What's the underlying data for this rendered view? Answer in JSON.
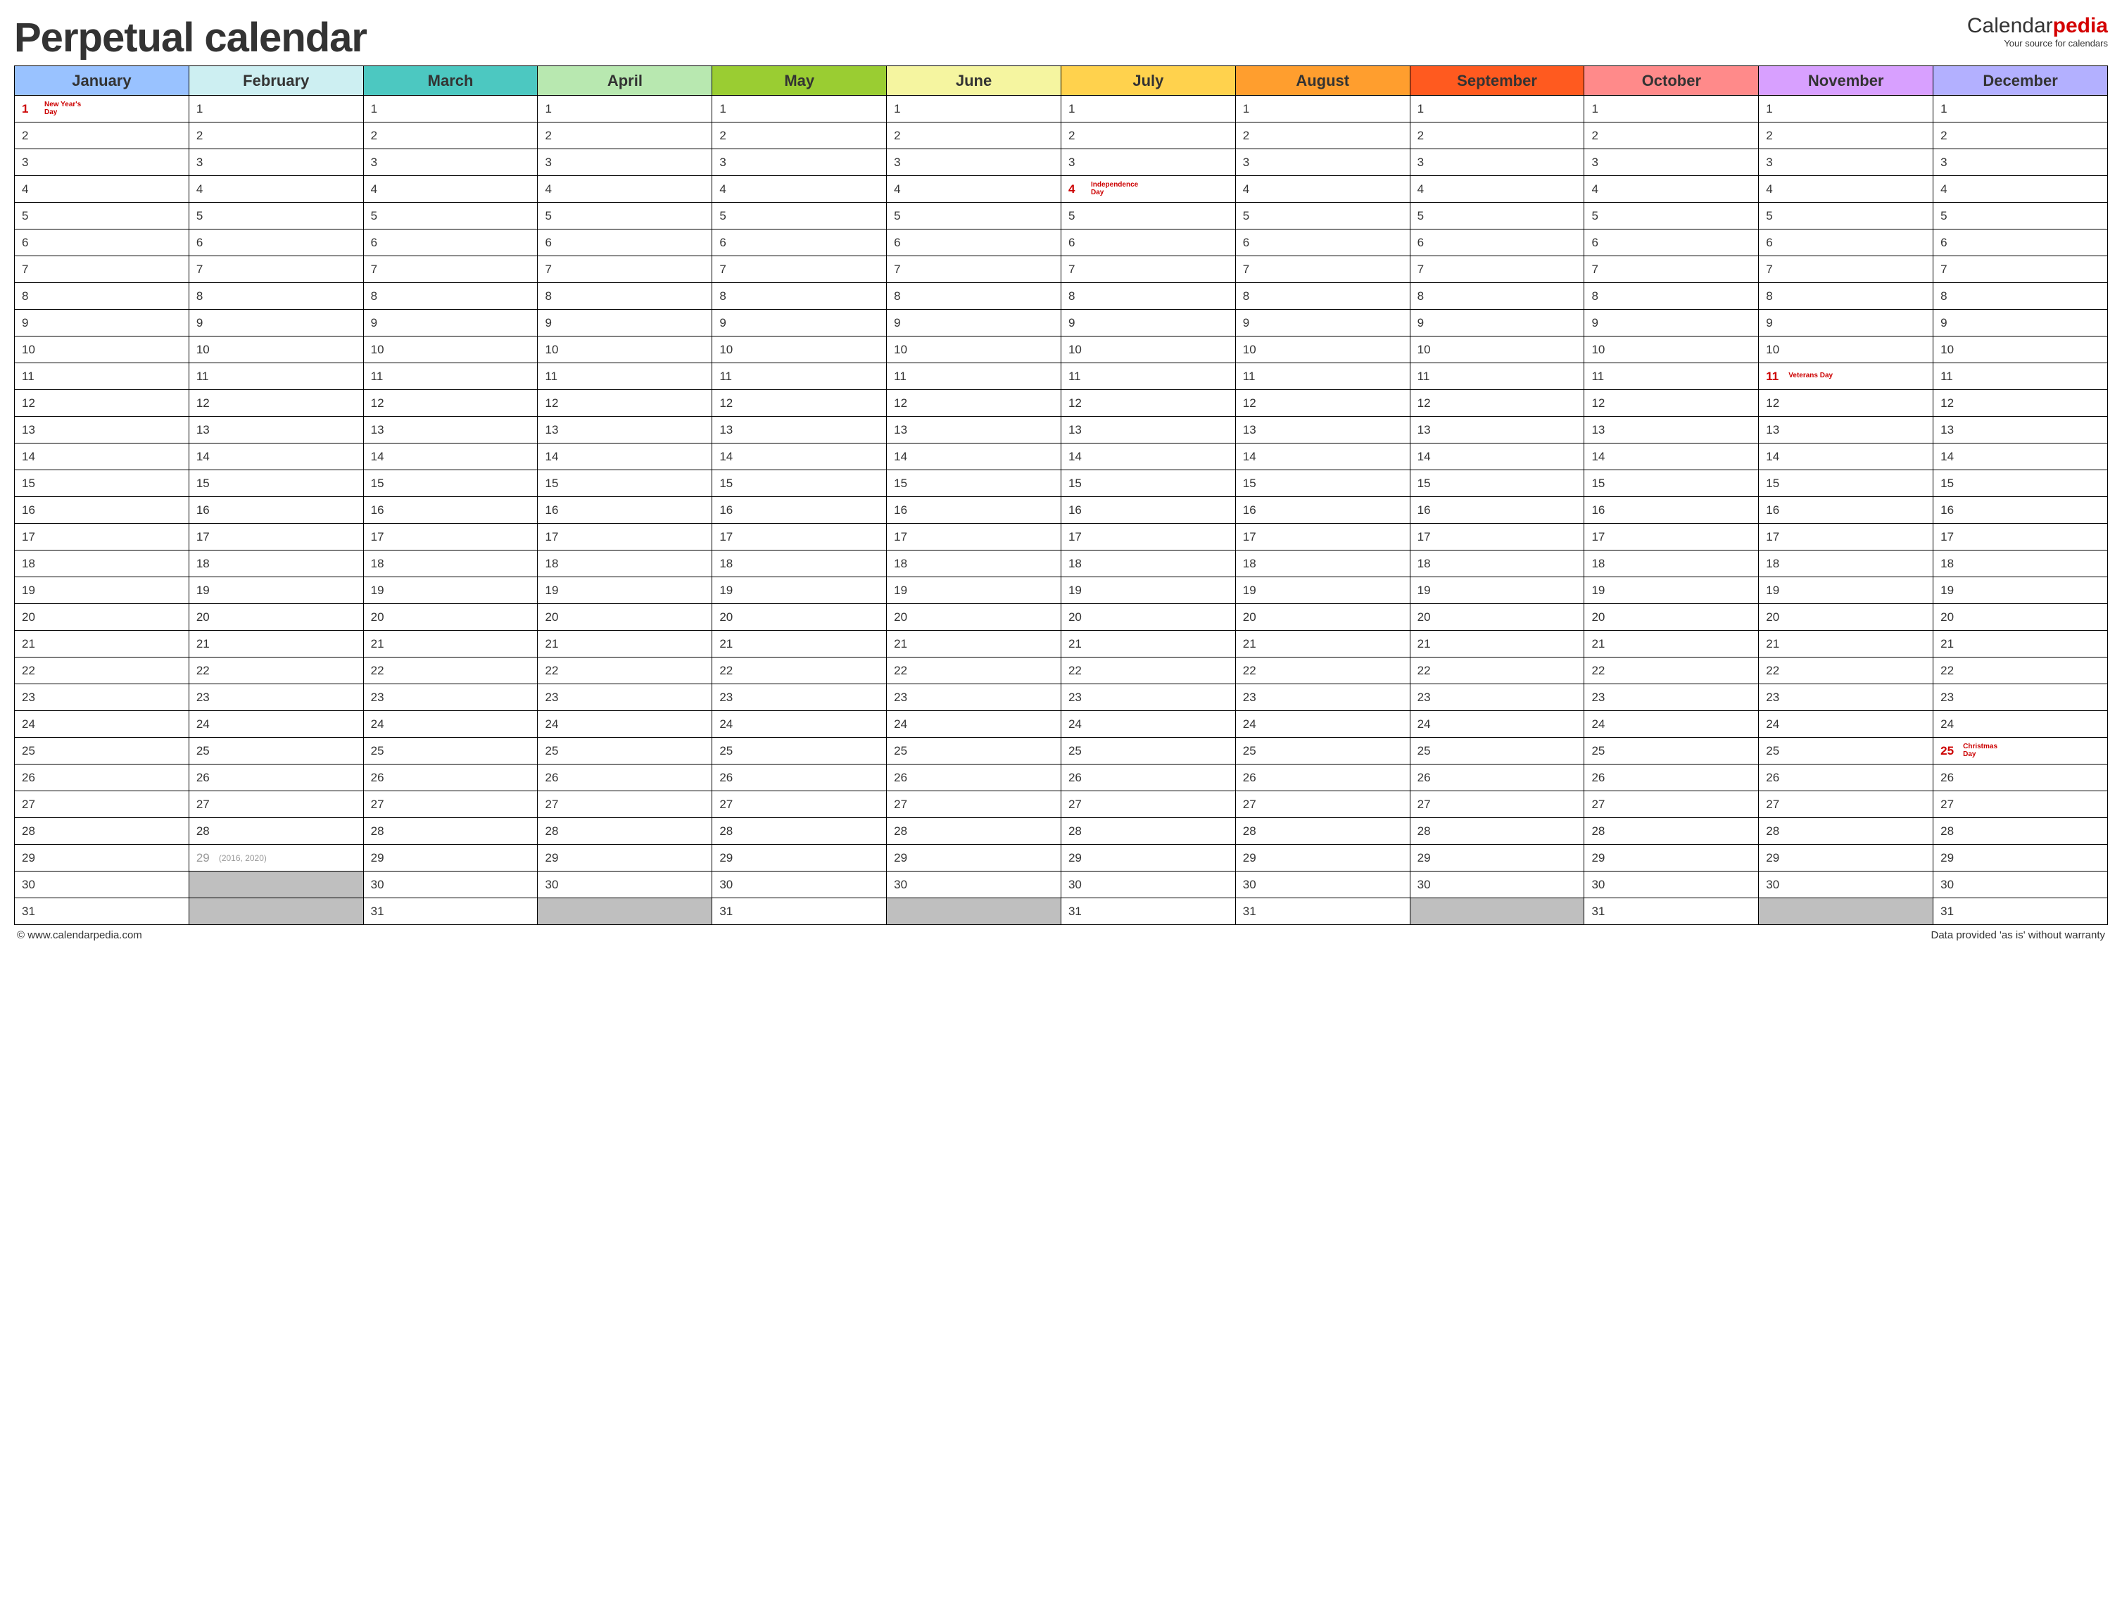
{
  "title": "Perpetual calendar",
  "brand": {
    "left": "Calendar",
    "right": "pedia",
    "tagline": "Your source for calendars"
  },
  "footer": {
    "left": "© www.calendarpedia.com",
    "right": "Data provided 'as is' without warranty"
  },
  "months": [
    {
      "name": "January",
      "color": "#99c2ff",
      "days": 31
    },
    {
      "name": "February",
      "color": "#cdeff2",
      "days": 29,
      "leap": {
        "day": 29,
        "note": "(2016, 2020)"
      }
    },
    {
      "name": "March",
      "color": "#4cc8c1",
      "days": 31
    },
    {
      "name": "April",
      "color": "#b8e8b0",
      "days": 30
    },
    {
      "name": "May",
      "color": "#9acd32",
      "days": 31
    },
    {
      "name": "June",
      "color": "#f5f5a0",
      "days": 30
    },
    {
      "name": "July",
      "color": "#ffd24d",
      "days": 31
    },
    {
      "name": "August",
      "color": "#ff9e2e",
      "days": 31
    },
    {
      "name": "September",
      "color": "#ff5a1f",
      "days": 30
    },
    {
      "name": "October",
      "color": "#ff8a8a",
      "days": 31
    },
    {
      "name": "November",
      "color": "#d8a0ff",
      "days": 30
    },
    {
      "name": "December",
      "color": "#b3b0ff",
      "days": 31
    }
  ],
  "holidays": [
    {
      "month": 0,
      "day": 1,
      "label": "New Year's Day"
    },
    {
      "month": 6,
      "day": 4,
      "label": "Independence Day"
    },
    {
      "month": 10,
      "day": 11,
      "label": "Veterans Day"
    },
    {
      "month": 11,
      "day": 25,
      "label": "Christmas Day"
    }
  ],
  "max_days": 31
}
